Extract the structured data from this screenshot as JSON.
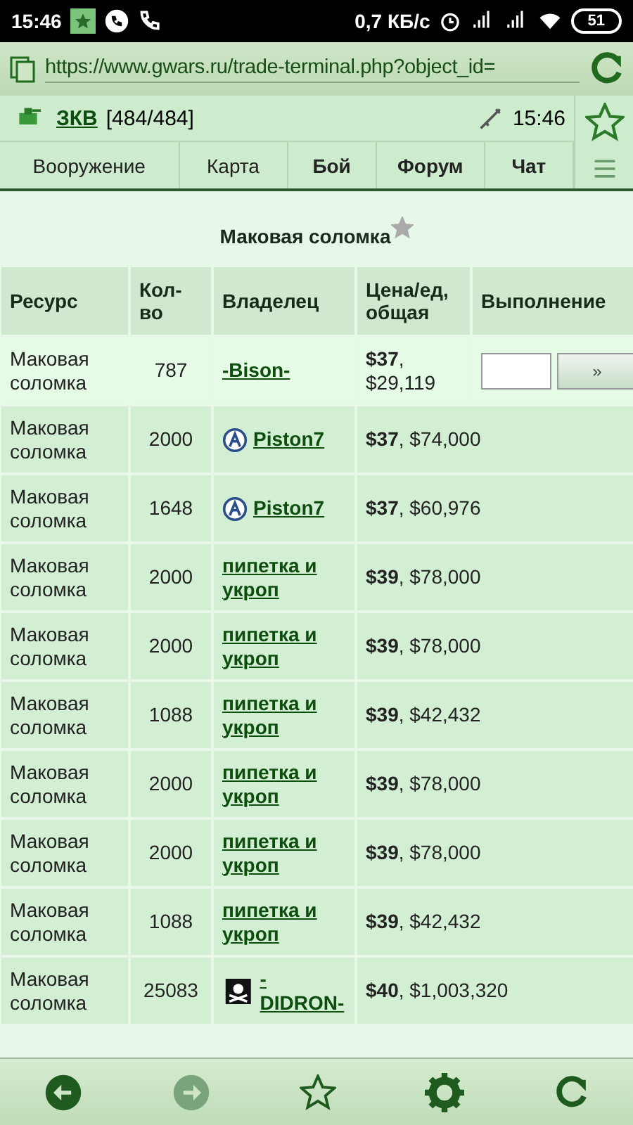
{
  "status_bar": {
    "time": "15:46",
    "speed": "0,7 КБ/с",
    "battery": "51"
  },
  "browser": {
    "url": "https://www.gwars.ru/trade-terminal.php?object_id="
  },
  "header": {
    "user": "ЗКВ",
    "hp": "[484/484]",
    "clock": "15:46"
  },
  "nav": [
    {
      "label": "Вооружение",
      "bold": false
    },
    {
      "label": "Карта",
      "bold": false
    },
    {
      "label": "Бой",
      "bold": true
    },
    {
      "label": "Форум",
      "bold": true
    },
    {
      "label": "Чат",
      "bold": true
    }
  ],
  "title": "Маковая соломка",
  "table": {
    "columns": [
      "Ресурс",
      "Кол-во",
      "Владелец",
      "Цена/ед, общая",
      "Выполнение"
    ],
    "rows": [
      {
        "kind": "offer",
        "resource": "Маковая соломка",
        "qty": "787",
        "owner": {
          "kind": "plain",
          "name": "-Bison-"
        },
        "price": "**$37**,",
        "total": "$29,119",
        "action": "»"
      },
      {
        "kind": "plain",
        "resource": "Маковая соломка",
        "qty": "2000",
        "owner": {
          "kind": "clan",
          "name": "Piston7"
        },
        "price": "**$37**, $74,000"
      },
      {
        "kind": "plain",
        "resource": "Маковая соломка",
        "qty": "1648",
        "owner": {
          "kind": "clan",
          "name": "Piston7"
        },
        "price": "**$37**, $60,976"
      },
      {
        "kind": "plain",
        "resource": "Маковая соломка",
        "qty": "2000",
        "owner": {
          "kind": "plain",
          "name": "пипетка и укроп"
        },
        "price": "**$39**, $78,000"
      },
      {
        "kind": "plain",
        "resource": "Маковая соломка",
        "qty": "2000",
        "owner": {
          "kind": "plain",
          "name": "пипетка и укроп"
        },
        "price": "**$39**, $78,000"
      },
      {
        "kind": "plain",
        "resource": "Маковая соломка",
        "qty": "1088",
        "owner": {
          "kind": "plain",
          "name": "пипетка и укроп"
        },
        "price": "**$39**, $42,432"
      },
      {
        "kind": "plain",
        "resource": "Маковая соломка",
        "qty": "2000",
        "owner": {
          "kind": "plain",
          "name": "пипетка и укроп"
        },
        "price": "**$39**, $78,000"
      },
      {
        "kind": "plain",
        "resource": "Маковая соломка",
        "qty": "2000",
        "owner": {
          "kind": "plain",
          "name": "пипетка и укроп"
        },
        "price": "**$39**, $78,000"
      },
      {
        "kind": "plain",
        "resource": "Маковая соломка",
        "qty": "1088",
        "owner": {
          "kind": "plain",
          "name": "пипетка и укроп"
        },
        "price": "**$39**, $42,432"
      },
      {
        "kind": "plain",
        "resource": "Маковая соломка",
        "qty": "25083",
        "owner": {
          "kind": "pirate",
          "name": "-DIDRON-"
        },
        "price": "**$40**, $1,003,320"
      }
    ]
  }
}
